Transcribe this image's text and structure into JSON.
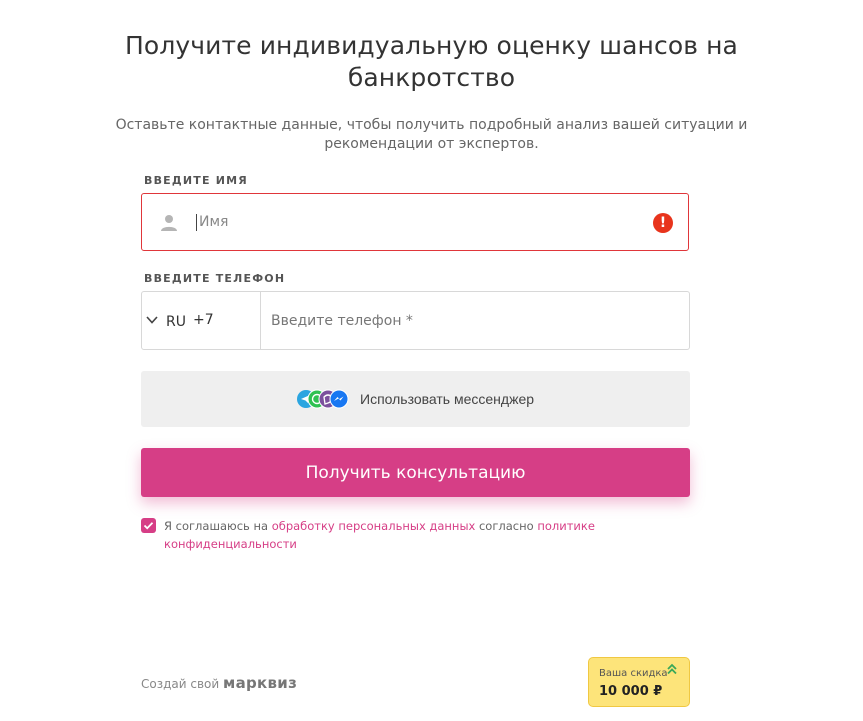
{
  "header": {
    "title": "Получите индивидуальную оценку шансов на банкротство",
    "subtitle": "Оставьте контактные данные, чтобы получить подробный анализ вашей ситуации и рекомендации от экспертов."
  },
  "name_field": {
    "label": "Введите имя",
    "placeholder": "Имя",
    "value": "",
    "error": "!"
  },
  "phone_field": {
    "label": "Введите телефон",
    "country_code": "RU",
    "dial_code": "+7",
    "placeholder": "Введите телефон *",
    "value": ""
  },
  "messenger_button": {
    "label": "Использовать мессенджер",
    "icons": [
      "telegram-icon",
      "whatsapp-icon",
      "viber-icon",
      "messenger-icon"
    ]
  },
  "submit_button": {
    "label": "Получить консультацию"
  },
  "consent": {
    "checked": true,
    "text_before": "Я соглашаюсь на ",
    "link1": "обработку персональных данных",
    "text_middle": " согласно ",
    "link2": "политике конфиденциальности"
  },
  "footer": {
    "made_with": "Создай свой",
    "brand": "марквиз"
  },
  "discount_badge": {
    "label": "Ваша скидка",
    "value": "10 000 ₽"
  },
  "colors": {
    "accent": "#d63e86",
    "error": "#e8341c",
    "badge_bg": "#fde47a"
  }
}
